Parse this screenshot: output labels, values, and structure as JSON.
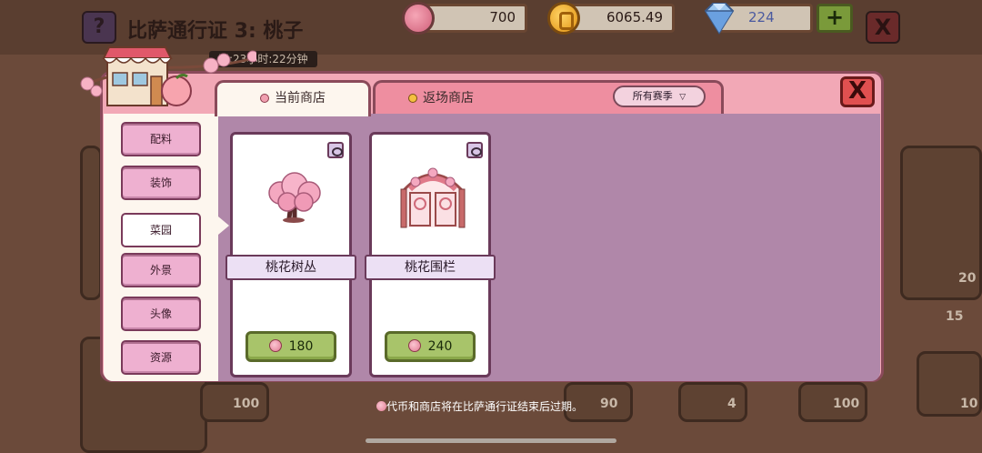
{
  "background": {
    "help_label": "?",
    "title": "比萨通行证 3: 桃子",
    "timer": "天:23小时:22分钟",
    "close_label": "X",
    "badges": [
      "100",
      "100",
      "90",
      "4",
      "100",
      "10",
      "20",
      "15"
    ]
  },
  "currency": {
    "peach_tokens": "700",
    "coins": "6065.49",
    "gems": "224",
    "add_label": "+"
  },
  "store": {
    "tabs": [
      {
        "label": "当前商店"
      },
      {
        "label": "返场商店"
      }
    ],
    "season_filter": "所有赛季",
    "close_label": "X",
    "categories": [
      {
        "label": "配料"
      },
      {
        "label": "装饰"
      },
      {
        "label": "菜园"
      },
      {
        "label": "外景"
      },
      {
        "label": "头像"
      },
      {
        "label": "资源"
      }
    ],
    "active_category": "菜园",
    "items": [
      {
        "name": "桃花树丛",
        "price": "180"
      },
      {
        "name": "桃花围栏",
        "price": "240"
      }
    ],
    "footer_note": "代币和商店将在比萨通行证结束后过期。"
  },
  "colors": {
    "modal_pink": "#f2a8b6",
    "content_purple": "#b087a9",
    "buy_green": "#a8c46a",
    "close_red": "#e05050"
  }
}
